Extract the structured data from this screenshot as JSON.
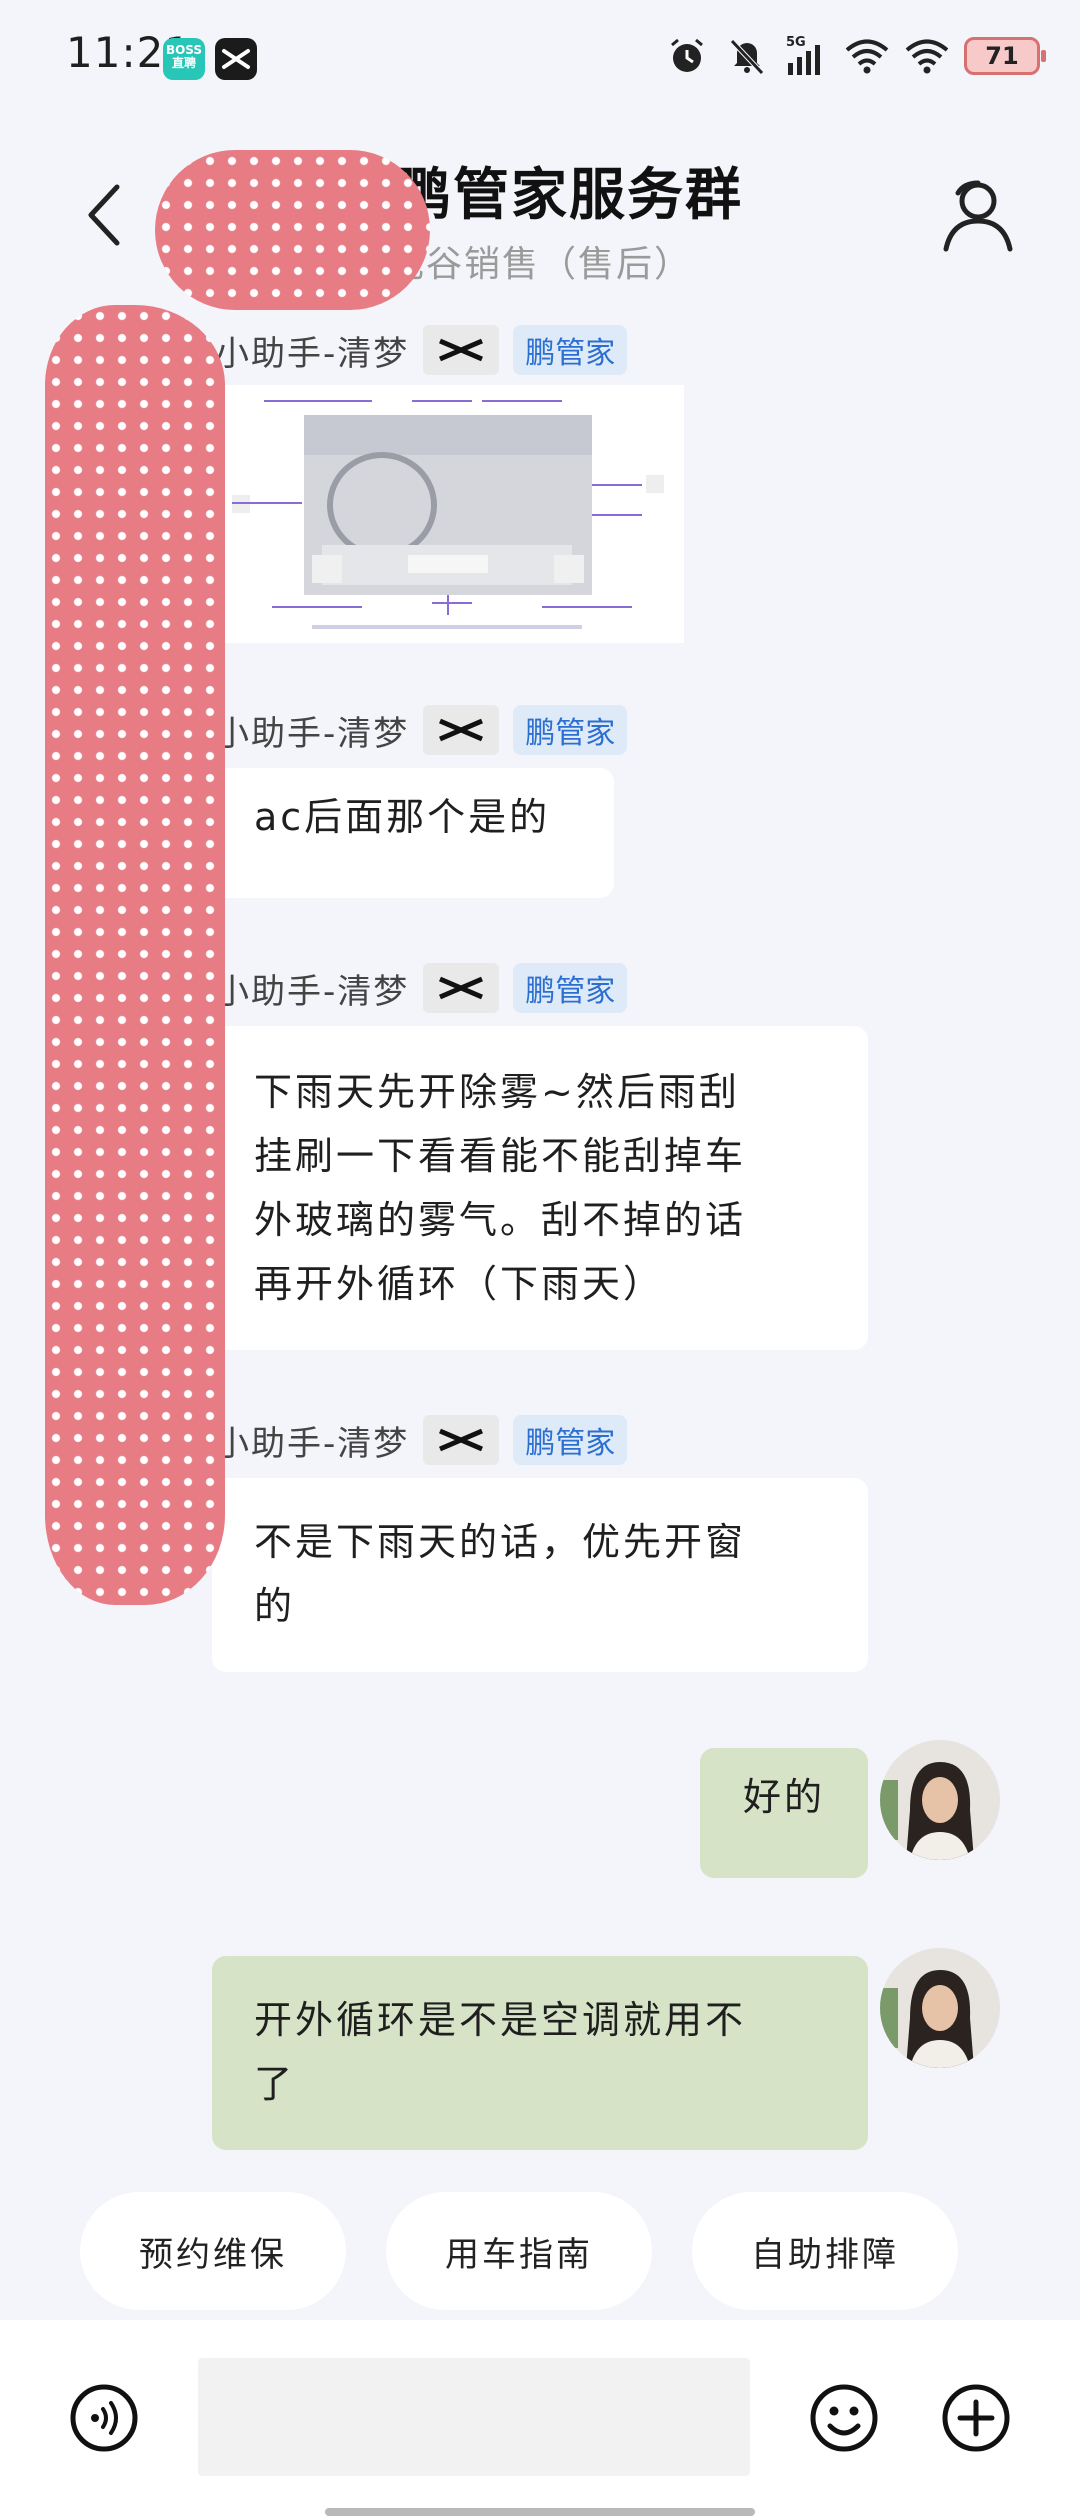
{
  "status_bar": {
    "time": "11:21",
    "boss_app_label": "BOSS\n直聘",
    "network": "5G",
    "battery": "71",
    "icons": [
      "boss-zhipin-icon",
      "xpeng-app-icon",
      "alarm-icon",
      "mute-icon",
      "signal-5g-icon",
      "wifi-icon",
      "wifi-2-icon",
      "battery-icon"
    ]
  },
  "header": {
    "title": "的鹏管家服务群",
    "subtitle": "光谷销售（售后）"
  },
  "messages": [
    {
      "sender": "小助手-清梦",
      "role_tag": "鹏管家",
      "type": "image",
      "image_desc": "dashboard-guide-image"
    },
    {
      "sender": "小助手-清梦",
      "role_tag": "鹏管家",
      "type": "text",
      "text": "ac后面那个是的"
    },
    {
      "sender": "小助手-清梦",
      "role_tag": "鹏管家",
      "type": "text",
      "text": "下雨天先开除雾~然后雨刮\n挂刷一下看看能不能刮掉车\n外玻璃的雾气。刮不掉的话\n再开外循环（下雨天）"
    },
    {
      "sender": "小助手-清梦",
      "role_tag": "鹏管家",
      "type": "text",
      "text": "不是下雨天的话，优先开窗\n的"
    },
    {
      "sender": "self",
      "type": "text",
      "text": "好的"
    },
    {
      "sender": "self",
      "type": "text",
      "text": "开外循环是不是空调就用不\n了"
    }
  ],
  "quick_actions": [
    "预约维保",
    "用车指南",
    "自助排障"
  ],
  "input": {
    "placeholder": ""
  },
  "colors": {
    "background": "#f3f5fa",
    "self_bubble": "#d6e3c6",
    "other_bubble": "#ffffff",
    "role_tag_text": "#2c6fd1",
    "role_tag_bg": "#dfeaf8",
    "redaction": "#e77c85"
  }
}
